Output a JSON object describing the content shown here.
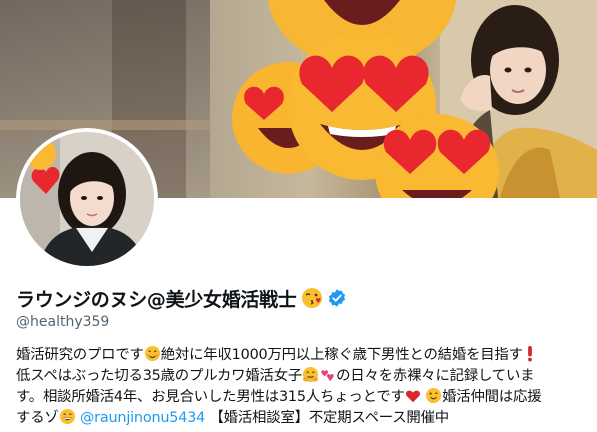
{
  "profile": {
    "display_name": "ラウンジのヌシ@美少女婚活戦士",
    "handle": "@healthy359",
    "verified": true,
    "bio": {
      "line1": "婚活研究のプロです",
      "line1b": "絶対に年収1000万円以上稼ぐ歳下男性との結婚を目指す",
      "line2a": "低スペはぶった切る35歳のプルカワ婚活女子",
      "line2b": "の日々を赤裸々に記録していま",
      "line3a": "す。相談所婚活4年、お見合いした男性は315人ちょっとです",
      "line3b": "婚活仲間は応援",
      "line4a": "するゾ",
      "mention": "@raunjinonu5434",
      "line4b": "【婚活相談室】不定期スペース開催中"
    }
  },
  "icons": {
    "verified_badge": "verified-badge-icon",
    "name_emoji": "face-blowing-kiss-icon",
    "banner_emoji": "heart-eyes-emoji-icon",
    "bio_emojis": [
      "smiling-face-icon",
      "exclamation-icon",
      "hug-face-icon",
      "two-hearts-icon",
      "red-heart-icon",
      "winking-face-icon",
      "grinning-face-icon"
    ]
  },
  "colors": {
    "link": "#1d9bf0",
    "text": "#0f1419",
    "secondary": "#536471"
  }
}
